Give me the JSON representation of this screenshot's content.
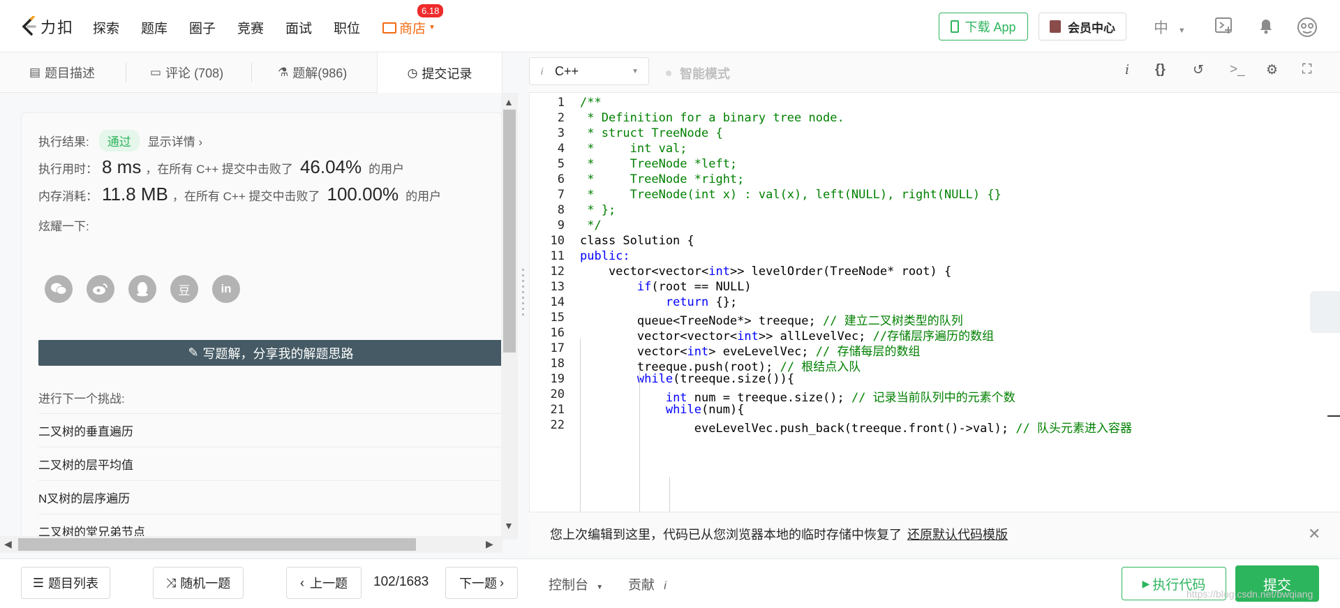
{
  "navbar": {
    "logo_text": "力扣",
    "items": [
      "探索",
      "题库",
      "圈子",
      "竞赛",
      "面试",
      "职位"
    ],
    "shop_label": "商店",
    "shop_badge": "6.18",
    "download_app": "下载 App",
    "vip_center": "会员中心",
    "language": "中"
  },
  "left_tabs": [
    {
      "label": "题目描述"
    },
    {
      "label": "评论 (708)"
    },
    {
      "label": "题解(986)"
    },
    {
      "label": "提交记录"
    }
  ],
  "result": {
    "exec_result_label": "执行结果:",
    "status": "通过",
    "show_details": "显示详情",
    "time_label": "执行用时：",
    "time_value": "8 ms",
    "time_mid": "，在所有 C++ 提交中击败了",
    "time_percent": "46.04%",
    "time_suffix": "的用户",
    "mem_label": "内存消耗：",
    "mem_value": "11.8 MB",
    "mem_mid": "，在所有 C++ 提交中击败了",
    "mem_percent": "100.00%",
    "mem_suffix": "的用户",
    "share_label": "炫耀一下:",
    "share_icons": [
      "wechat-icon",
      "weibo-icon",
      "qq-icon",
      "douban-icon",
      "linkedin-icon"
    ],
    "douban_glyph": "豆",
    "linkedin_glyph": "in",
    "write_solution": "写题解，分享我的解题思路",
    "next_challenge_label": "进行下一个挑战:",
    "next_challenges": [
      "二叉树的垂直遍历",
      "二叉树的层平均值",
      "N叉树的层序遍历",
      "二叉树的堂兄弟节点"
    ]
  },
  "editor": {
    "language": "C++",
    "smart_mode": "智能模式",
    "lines": [
      {
        "n": "1",
        "html": "/**",
        "cls": "c"
      },
      {
        "n": "2",
        "html": " * Definition for a binary tree node.",
        "cls": "c"
      },
      {
        "n": "3",
        "html": " * struct TreeNode {",
        "cls": "c"
      },
      {
        "n": "4",
        "html": " *     int val;",
        "cls": "c"
      },
      {
        "n": "5",
        "html": " *     TreeNode *left;",
        "cls": "c"
      },
      {
        "n": "6",
        "html": " *     TreeNode *right;",
        "cls": "c"
      },
      {
        "n": "7",
        "html": " *     TreeNode(int x) : val(x), left(NULL), right(NULL) {}",
        "cls": "c"
      },
      {
        "n": "8",
        "html": " * };",
        "cls": "c"
      },
      {
        "n": "9",
        "html": " */",
        "cls": "c"
      },
      {
        "n": "10",
        "html": "class Solution {",
        "cls": ""
      },
      {
        "n": "11",
        "html": "public:",
        "cls": "k"
      },
      {
        "n": "12",
        "html": "    vector<vector<int>> levelOrder(TreeNode* root) {",
        "cls": ""
      },
      {
        "n": "13",
        "html": "        if(root == NULL)",
        "cls": ""
      },
      {
        "n": "14",
        "html": "            return {};",
        "cls": ""
      },
      {
        "n": "15",
        "html": "        queue<TreeNode*> treeque; // 建立二叉树类型的队列",
        "cls": ""
      },
      {
        "n": "16",
        "html": "        vector<vector<int>> allLevelVec; //存储层序遍历的数组",
        "cls": ""
      },
      {
        "n": "17",
        "html": "        vector<int> eveLevelVec; // 存储每层的数组",
        "cls": ""
      },
      {
        "n": "18",
        "html": "        treeque.push(root); // 根结点入队",
        "cls": ""
      },
      {
        "n": "19",
        "html": "        while(treeque.size()){",
        "cls": ""
      },
      {
        "n": "20",
        "html": "            int num = treeque.size(); // 记录当前队列中的元素个数",
        "cls": ""
      },
      {
        "n": "21",
        "html": "            while(num){",
        "cls": ""
      },
      {
        "n": "22",
        "html": "                eveLevelVec.push_back(treeque.front()->val); // 队头元素进入容器",
        "cls": ""
      }
    ],
    "restore_text": "您上次编辑到这里，代码已从您浏览器本地的临时存储中恢复了",
    "restore_link": "还原默认代码模版"
  },
  "bottom": {
    "problem_list": "题目列表",
    "random": "随机一题",
    "prev": "上一题",
    "page": "102/1683",
    "next": "下一题",
    "console": "控制台",
    "contribute": "贡献",
    "run_code": "执行代码",
    "submit": "提交",
    "watermark": "https://blog.csdn.net/bwqiang"
  },
  "colors": {
    "accent": "#2db55d",
    "shop": "#f26b12",
    "badge": "#ef2b2b",
    "write_btn": "#455a64"
  }
}
